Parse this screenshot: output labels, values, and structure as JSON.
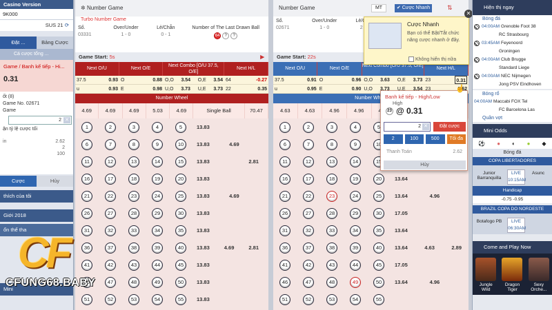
{
  "left": {
    "version": "Casino Version",
    "user": "9K000",
    "balance": "SUS 21",
    "tabs": [
      "Đặt ...",
      "Bảng Cược"
    ],
    "sub": "Cá cược tổng ...",
    "slip_title": "Game / Banh kế tiếp - Hi...",
    "slip_odd": "0.31",
    "draw_text": "ốt (8)",
    "game_no": "Game No. 02671",
    "game_label": "Game",
    "stake": "2",
    "auto": "ận tỷ lệ cược tối",
    "rows": [
      {
        "k": "in",
        "v": "2.62"
      },
      {
        "k": "",
        "v": "2"
      },
      {
        "k": "",
        "v": "100"
      }
    ],
    "bet_btn": "Cược",
    "cancel_btn": "Hủy",
    "nav": [
      "thích của tôi",
      "Giới 2018",
      "ổn thể tha",
      "Mini"
    ]
  },
  "panel1": {
    "title": "Number Game",
    "sub": "Turbo Number Game",
    "so_label": "Số.",
    "so": "03331",
    "ou_label": "Over/Under",
    "ou": "1 - 0",
    "lc_label": "Lẻ/Chẵn",
    "lc": "0 - 1",
    "last_label": "Number of The Last Drawn Ball",
    "last_balls": [
      "64",
      "?",
      "?"
    ],
    "start": "Game Start:",
    "start_t": "5s",
    "headers": [
      "Next O/U",
      "Next O/E",
      "Next Combo [O/U 37.5, O/E]",
      "Next H/L"
    ],
    "odds_r1": [
      "37.5",
      "0.93",
      "O",
      "0.88",
      "O,O",
      "3.54",
      "O,E",
      "3.54",
      "64",
      "-0.27"
    ],
    "odds_r2": [
      "u",
      "0.93",
      "E",
      "0.98",
      "U,O",
      "3.73",
      "U,E",
      "3.73",
      "22",
      "0.35"
    ],
    "wheel": "Number Wheel",
    "wheel_vals": [
      "4.69",
      "4.69",
      "4.69",
      "5.03",
      "4.69",
      "Single Ball",
      "70.47"
    ],
    "scores": [
      "13.83",
      "13.83",
      "13.83",
      "13.83",
      "13.83",
      "13.83",
      "13.83",
      "13.83",
      "13.83",
      "13.83",
      "13.83"
    ],
    "mids": [
      "4.69",
      "4.69",
      "4.69"
    ],
    "rights": [
      "2.81",
      "2.81"
    ]
  },
  "panel2": {
    "title": "Number Game",
    "so_label": "Số.",
    "so": "02671",
    "ou_label": "Over/Under",
    "ou": "1 - 0",
    "lc_label": "Lẻ/Chẵn",
    "lc": "2 - 0",
    "start": "Game Start:",
    "start_t": "22s",
    "headers": [
      "Next O/U",
      "Next O/E",
      "Next Combo [O/U 37.5, O/E]",
      "Next H/L"
    ],
    "odds_r1": [
      "37.5",
      "0.91",
      "O",
      "0.96",
      "O,O",
      "3.63",
      "O,E",
      "3.73",
      "23",
      "0.31"
    ],
    "odds_r2": [
      "u",
      "0.95",
      "E",
      "0.90",
      "U,O",
      "3.73",
      "U,E",
      "3.54",
      "23",
      "2.62"
    ],
    "wheel": "Number Wheel",
    "wheel_vals": [
      "4.63",
      "4.63",
      "4.96",
      "4.96",
      "4.63"
    ],
    "scores": [
      "13.64",
      "13.64",
      "17.05",
      "13.64",
      "13.64",
      "17.05",
      "13.64"
    ],
    "mids": [
      "4.96",
      "4.63",
      "4.96"
    ],
    "right": "2.89"
  },
  "toolbar": {
    "mt": "MT",
    "quick": "Cược Nhanh"
  },
  "popup": {
    "title": "Cược Nhanh",
    "desc": "Bạn có thể Bật/Tắt chức năng cược nhanh ở đây.",
    "check": "Không hiển thị nữa"
  },
  "betslip": {
    "title": "Banh kế tiếp - High/Low",
    "high": "High",
    "ball": "23",
    "odd": "@ 0.31",
    "stake": "2",
    "place": "Đặt cược",
    "quick": [
      "2",
      "100",
      "500",
      "Tối đa"
    ],
    "pay_label": "Thanh Toán",
    "pay": "2.62",
    "cancel": "Hủy"
  },
  "right": {
    "head": "Hiện thị ngay",
    "football": "Bóng đá",
    "matches": [
      {
        "t": "04:00AM",
        "n": "Grenoble Foot 38"
      },
      {
        "t": "",
        "n": "RC Strasbourg"
      },
      {
        "t": "03:45AM",
        "n": "Feyenoord"
      },
      {
        "t": "",
        "n": "Groningen"
      },
      {
        "t": "04:00AM",
        "n": "Club Brugge"
      },
      {
        "t": "",
        "n": "Standard Liege"
      },
      {
        "t": "04:00AM",
        "n": "NEC Nijmegen"
      },
      {
        "t": "",
        "n": "Jong PSV Eindhoven"
      }
    ],
    "basketball": "Bóng rổ",
    "bmatches": [
      {
        "t": "04:00AM",
        "n": "Maccabi FOX Tel"
      },
      {
        "t": "",
        "n": "FC Barcelona Las"
      }
    ],
    "more": "Quần vợt",
    "mini": "Mini Odds",
    "mini_sub": "Bóng đá",
    "league1": "COPA LIBERTADORES",
    "m1a": "Junior Barranquilla",
    "m1b": "Asunc",
    "m1live": "LIVE",
    "m1time": "10:15AM",
    "hcap": "Handicap",
    "h1": "-0.75   -0.95",
    "league2": "BRAZIL COPA DO NORDESTE",
    "m2a": "Botafogo PB",
    "m2live": "LIVE",
    "m2time": "06:30AM",
    "come": "Come and Play Now",
    "games": [
      "Jungle Wild",
      "Dragon Tiger",
      "Sexy Orche..."
    ]
  },
  "logo": {
    "text": "CF",
    "url": "CFUNG68.BABY"
  }
}
